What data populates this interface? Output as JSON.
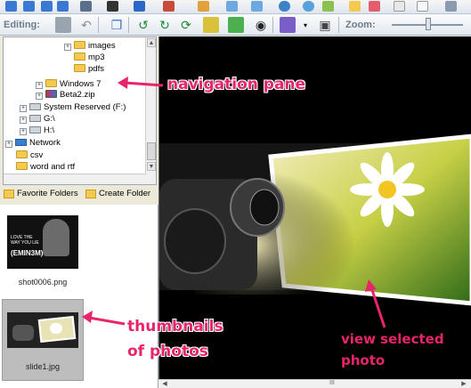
{
  "toolbar": {
    "editing_label": "Editing:",
    "zoom_label": "Zoom:"
  },
  "tree": {
    "items": [
      {
        "label": "images",
        "type": "folder"
      },
      {
        "label": "mp3",
        "type": "folder"
      },
      {
        "label": "pdfs",
        "type": "folder"
      },
      {
        "label": "Windows 7",
        "type": "folder"
      },
      {
        "label": "Beta2.zip",
        "type": "archive"
      },
      {
        "label": "System Reserved (F:)",
        "type": "drive"
      },
      {
        "label": "G:\\",
        "type": "drive"
      },
      {
        "label": "H:\\",
        "type": "drive"
      },
      {
        "label": "Network",
        "type": "network"
      },
      {
        "label": "csv",
        "type": "folder"
      },
      {
        "label": "word and rtf",
        "type": "folder"
      }
    ]
  },
  "folder_buttons": {
    "favorite": "Favorite Folders",
    "create": "Create Folder"
  },
  "thumbnails": [
    {
      "filename": "shot0006.png",
      "image_text": [
        "LOVE THE",
        "WAY YOU LIE",
        "(EMIN3M)"
      ]
    },
    {
      "filename": "slide1.jpg",
      "image_text": []
    }
  ],
  "annotations": {
    "navigation": "navigation pane",
    "thumbnails_line1": "thumbnails",
    "thumbnails_line2": "of photos",
    "view_line1": "view selected",
    "view_line2": "photo"
  },
  "scroll": {
    "grip": "III"
  },
  "colors": {
    "annotation": "#e8246a",
    "viewer_bg": "#000000",
    "selected_thumb_bg": "#bdbdbd"
  }
}
